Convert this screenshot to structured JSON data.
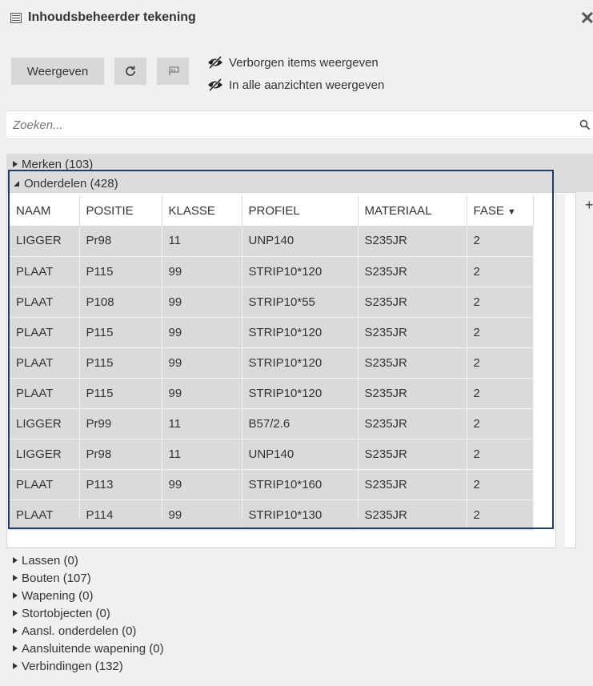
{
  "window": {
    "title": "Inhoudsbeheerder tekening",
    "close_glyph": "✕"
  },
  "toolbar": {
    "show_label": "Weergeven",
    "refresh_icon": "refresh-icon",
    "flag_icon": "flag-icon",
    "toggle_hidden": "Verborgen items weergeven",
    "toggle_all_views": "In alle aanzichten weergeven"
  },
  "search": {
    "placeholder": "Zoeken..."
  },
  "categories": {
    "merken": "Merken (103)",
    "onderdelen": "Onderdelen (428)"
  },
  "table": {
    "headers": [
      "NAAM",
      "POSITIE",
      "KLASSE",
      "PROFIEL",
      "MATERIAAL",
      "FASE"
    ],
    "rows": [
      [
        "LIGGER",
        "Pr98",
        "11",
        "UNP140",
        "S235JR",
        "2"
      ],
      [
        "PLAAT",
        "P115",
        "99",
        "STRIP10*120",
        "S235JR",
        "2"
      ],
      [
        "PLAAT",
        "P108",
        "99",
        "STRIP10*55",
        "S235JR",
        "2"
      ],
      [
        "PLAAT",
        "P115",
        "99",
        "STRIP10*120",
        "S235JR",
        "2"
      ],
      [
        "PLAAT",
        "P115",
        "99",
        "STRIP10*120",
        "S235JR",
        "2"
      ],
      [
        "PLAAT",
        "P115",
        "99",
        "STRIP10*120",
        "S235JR",
        "2"
      ],
      [
        "LIGGER",
        "Pr99",
        "11",
        "B57/2.6",
        "S235JR",
        "2"
      ],
      [
        "LIGGER",
        "Pr98",
        "11",
        "UNP140",
        "S235JR",
        "2"
      ],
      [
        "PLAAT",
        "P113",
        "99",
        "STRIP10*160",
        "S235JR",
        "2"
      ],
      [
        "PLAAT",
        "P114",
        "99",
        "STRIP10*130",
        "S235JR",
        "2"
      ]
    ]
  },
  "lower_categories": [
    "Lassen (0)",
    "Bouten (107)",
    "Wapening (0)",
    "Stortobjecten (0)",
    "Aansl. onderdelen (0)",
    "Aansluitende wapening (0)",
    "Verbindingen (132)"
  ],
  "colors": {
    "selection_border": "#1f3f66",
    "row_bg": "#dadada",
    "header_bg": "#ffffff"
  }
}
